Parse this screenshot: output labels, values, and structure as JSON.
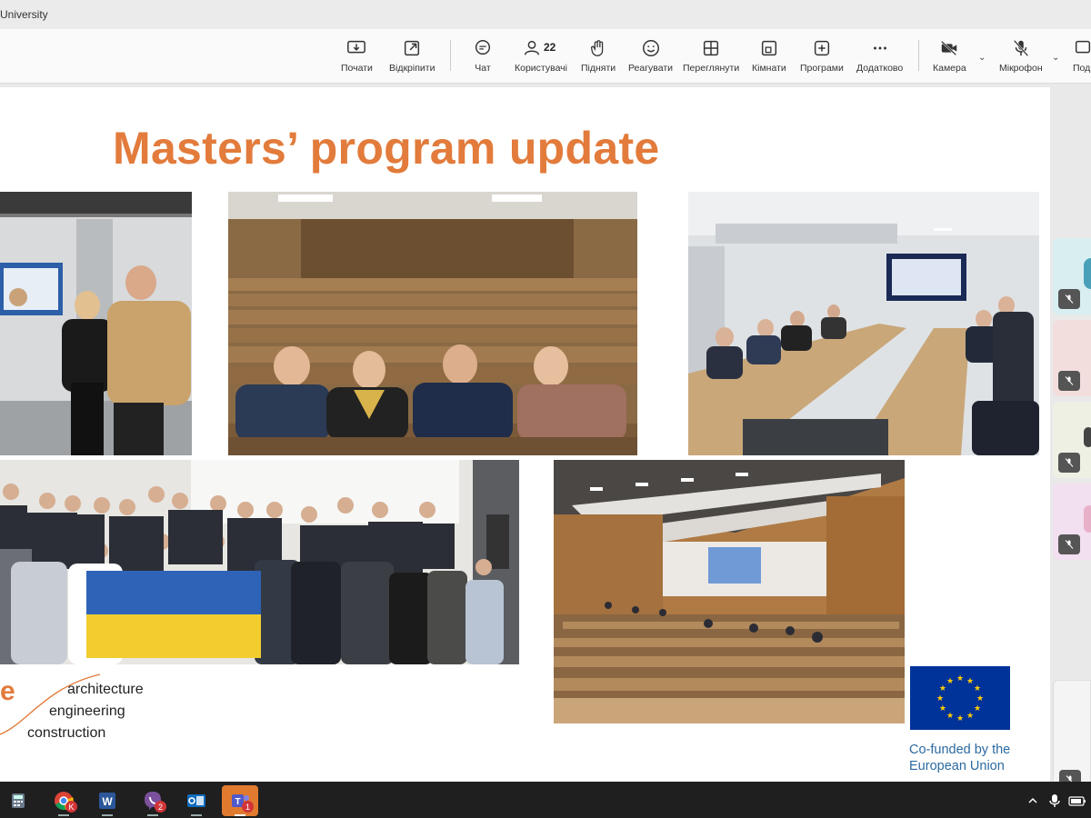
{
  "window": {
    "title": "University"
  },
  "toolbar": {
    "buttons": [
      {
        "id": "start",
        "label": "Почати",
        "icon": "share-screen-icon"
      },
      {
        "id": "popout",
        "label": "Відкріпити",
        "icon": "popout-icon"
      },
      {
        "id": "chat",
        "label": "Чат",
        "icon": "chat-icon"
      },
      {
        "id": "people",
        "label": "Користувачі",
        "icon": "people-icon",
        "count": "22"
      },
      {
        "id": "raise",
        "label": "Підняти",
        "icon": "hand-icon"
      },
      {
        "id": "react",
        "label": "Реагувати",
        "icon": "smile-icon"
      },
      {
        "id": "view",
        "label": "Переглянути",
        "icon": "grid-icon"
      },
      {
        "id": "rooms",
        "label": "Кімнати",
        "icon": "rooms-icon"
      },
      {
        "id": "apps",
        "label": "Програми",
        "icon": "apps-plus-icon"
      },
      {
        "id": "more",
        "label": "Додатково",
        "icon": "more-icon"
      },
      {
        "id": "camera",
        "label": "Камера",
        "icon": "camera-off-icon"
      },
      {
        "id": "mic",
        "label": "Мікрофон",
        "icon": "mic-off-icon"
      },
      {
        "id": "share",
        "label": "Под",
        "icon": "share-icon"
      }
    ]
  },
  "slide": {
    "title": "Masters’ program update",
    "logo": {
      "letter": "e",
      "line1": "architecture",
      "line2": "engineering",
      "line3": "construction"
    },
    "eu": {
      "line1": "Co-funded by the",
      "line2": "European Union"
    }
  },
  "taskbar": {
    "items": [
      {
        "name": "calculator-icon"
      },
      {
        "name": "chrome-icon",
        "badge": "K"
      },
      {
        "name": "word-icon"
      },
      {
        "name": "viber-icon",
        "badge": "2"
      },
      {
        "name": "outlook-icon"
      },
      {
        "name": "teams-icon",
        "badge": "1"
      }
    ]
  },
  "colors": {
    "accent": "#e27b3b",
    "eu_blue": "#003399",
    "eu_text": "#2c6aa0"
  }
}
